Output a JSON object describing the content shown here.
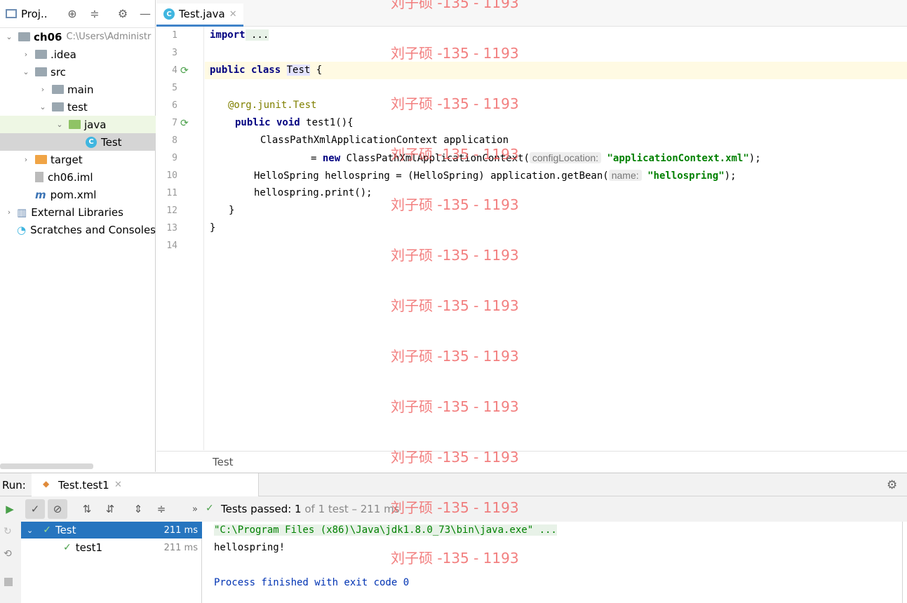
{
  "project_panel": {
    "title": "Proj..",
    "tree": [
      {
        "label": "ch06",
        "path": "C:\\Users\\Administr",
        "indent": 0,
        "arrow": "⌄",
        "icon": "folder-grey"
      },
      {
        "label": ".idea",
        "indent": 1,
        "arrow": "›",
        "icon": "folder-grey"
      },
      {
        "label": "src",
        "indent": 1,
        "arrow": "⌄",
        "icon": "folder-grey"
      },
      {
        "label": "main",
        "indent": 2,
        "arrow": "›",
        "icon": "folder-grey"
      },
      {
        "label": "test",
        "indent": 2,
        "arrow": "⌄",
        "icon": "folder-grey"
      },
      {
        "label": "java",
        "indent": 3,
        "arrow": "⌄",
        "icon": "folder-green"
      },
      {
        "label": "Test",
        "indent": 4,
        "arrow": "",
        "icon": "class"
      },
      {
        "label": "target",
        "indent": 1,
        "arrow": "›",
        "icon": "folder-orange"
      },
      {
        "label": "ch06.iml",
        "indent": 1,
        "arrow": "",
        "icon": "file"
      },
      {
        "label": "pom.xml",
        "indent": 1,
        "arrow": "",
        "icon": "maven"
      },
      {
        "label": "External Libraries",
        "indent": 0,
        "arrow": "›",
        "icon": "library"
      },
      {
        "label": "Scratches and Consoles",
        "indent": 0,
        "arrow": "",
        "icon": "scratch"
      }
    ]
  },
  "editor": {
    "tab_label": "Test.java",
    "line_numbers": [
      "1",
      "3",
      "4",
      "5",
      "6",
      "7",
      "8",
      "9",
      "10",
      "11",
      "12",
      "13",
      "14"
    ],
    "code": {
      "l1_kw": "import",
      "l1_rest": " ...",
      "l4_kw": "public class",
      "l4_cls": "Test",
      "l4_rest": " {",
      "l6_ann": "@org.junit.",
      "l6_ann2": "Test",
      "l7_kw": "public void",
      "l7_rest": " test1(){",
      "l8": "ClassPathXmlApplicationContext application",
      "l9_pre": "= ",
      "l9_kw": "new",
      "l9_mid": " ClassPathXmlApplicationContext(",
      "l9_hint": "configLocation:",
      "l9_str": "\"applicationContext.xml\"",
      "l9_end": ");",
      "l10_pre": "HelloSpring hellospring = (HelloSpring) application.getBean(",
      "l10_hint": "name:",
      "l10_str": "\"hellospring\"",
      "l10_end": ");",
      "l11": "hellospring.print();",
      "l12": "}",
      "l13": "}"
    },
    "breadcrumb": "Test"
  },
  "run_panel": {
    "label": "Run:",
    "tab_label": "Test.test1",
    "status_prefix": "Tests passed: ",
    "status_count": "1",
    "status_suffix": " of 1 test – 211 ms",
    "tests": [
      {
        "name": "Test",
        "time": "211 ms"
      },
      {
        "name": "test1",
        "time": "211 ms"
      }
    ],
    "console": [
      "\"C:\\Program Files (x86)\\Java\\jdk1.8.0_73\\bin\\java.exe\" ...",
      "hellospring!",
      "",
      "Process finished with exit code 0"
    ]
  },
  "watermark": "刘子硕 -135 - 1193",
  "colors": {
    "accent": "#4083c9",
    "selection": "#2675bf",
    "pass": "#4aa04a",
    "watermark": "#f06060"
  }
}
